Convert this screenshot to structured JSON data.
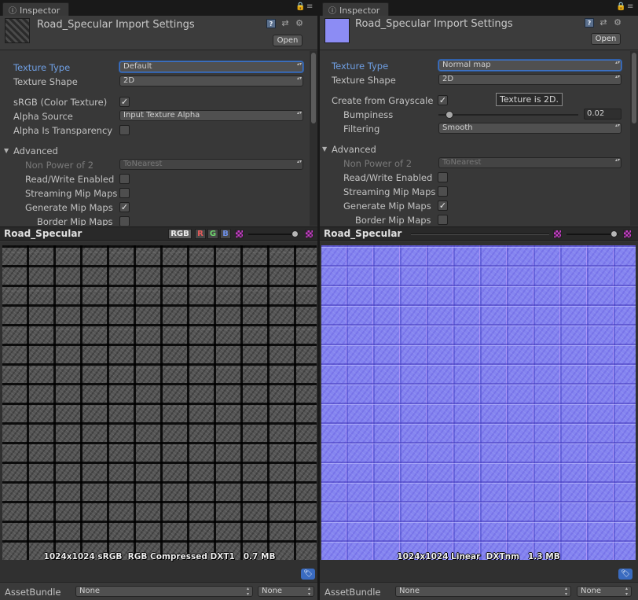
{
  "left": {
    "tab_label": "Inspector",
    "header_title": "Road_Specular Import Settings",
    "open_label": "Open",
    "texture_type_label": "Texture Type",
    "texture_type_value": "Default",
    "texture_shape_label": "Texture Shape",
    "texture_shape_value": "2D",
    "srgb_label": "sRGB (Color Texture)",
    "srgb_checked": "✓",
    "alpha_source_label": "Alpha Source",
    "alpha_source_value": "Input Texture Alpha",
    "alpha_transparency_label": "Alpha Is Transparency",
    "advanced_label": "Advanced",
    "npot_label": "Non Power of 2",
    "npot_value": "ToNearest",
    "readwrite_label": "Read/Write Enabled",
    "streaming_label": "Streaming Mip Maps",
    "genmip_label": "Generate Mip Maps",
    "genmip_checked": "✓",
    "bordermip_label": "Border Mip Maps",
    "preview_title": "Road_Specular",
    "channel_rgb": "RGB",
    "channel_r": "R",
    "channel_g": "G",
    "channel_b": "B",
    "texture_info": "1024x1024 sRGB  RGB Compressed DXT1   0.7 MB",
    "assetbundle_label": "AssetBundle",
    "assetbundle_value": "None",
    "assetbundle_variant": "None"
  },
  "right": {
    "tab_label": "Inspector",
    "header_title": "Road_Specular Import Settings",
    "open_label": "Open",
    "texture_type_label": "Texture Type",
    "texture_type_value": "Normal map",
    "texture_shape_label": "Texture Shape",
    "texture_shape_value": "2D",
    "grayscale_label": "Create from Grayscale",
    "grayscale_checked": "✓",
    "tooltip_text": "Texture is 2D.",
    "bumpiness_label": "Bumpiness",
    "bumpiness_value": "0.02",
    "bumpiness_fraction": 0.08,
    "filtering_label": "Filtering",
    "filtering_value": "Smooth",
    "advanced_label": "Advanced",
    "npot_label": "Non Power of 2",
    "npot_value": "ToNearest",
    "readwrite_label": "Read/Write Enabled",
    "streaming_label": "Streaming Mip Maps",
    "genmip_label": "Generate Mip Maps",
    "genmip_checked": "✓",
    "bordermip_label": "Border Mip Maps",
    "preview_title": "Road_Specular",
    "texture_info": "1024x1024 Linear  DXTnm   1.3 MB",
    "assetbundle_label": "AssetBundle",
    "assetbundle_value": "None",
    "assetbundle_variant": "None"
  },
  "colors": {
    "focus_blue": "#6f9fe3",
    "panel_bg": "#383838",
    "normal_map": "#8585f0"
  },
  "icons": [
    "info-icon",
    "lock-icon",
    "menu-icon",
    "help-book-icon",
    "preset-icon",
    "gear-icon",
    "checker-icon",
    "tag-icon"
  ]
}
